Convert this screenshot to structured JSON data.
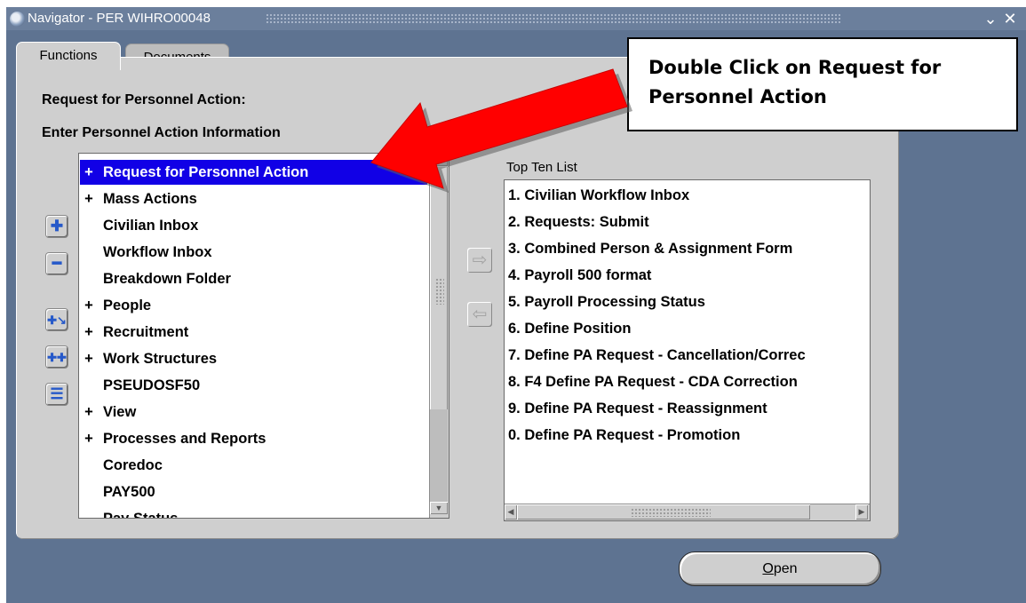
{
  "window": {
    "title": "Navigator - PER WIHRO00048",
    "minimize_glyph": "⯆",
    "close_glyph": "✕"
  },
  "tabs": [
    {
      "label": "Functions",
      "active": true
    },
    {
      "label": "Documents",
      "active": false
    }
  ],
  "headings": {
    "line1": "Request for Personnel Action:",
    "line2": "Enter Personnel Action Information"
  },
  "tree": {
    "items": [
      {
        "plus": "+",
        "label": "Request for Personnel Action",
        "selected": true
      },
      {
        "plus": "+",
        "label": "Mass Actions"
      },
      {
        "plus": "",
        "label": "Civilian Inbox"
      },
      {
        "plus": "",
        "label": "Workflow Inbox"
      },
      {
        "plus": "",
        "label": "Breakdown Folder"
      },
      {
        "plus": "+",
        "label": "People"
      },
      {
        "plus": "+",
        "label": "Recruitment"
      },
      {
        "plus": "+",
        "label": "Work Structures"
      },
      {
        "plus": "",
        "label": "PSEUDOSF50"
      },
      {
        "plus": "+",
        "label": "View"
      },
      {
        "plus": "+",
        "label": "Processes and Reports"
      },
      {
        "plus": "",
        "label": "Coredoc"
      },
      {
        "plus": "",
        "label": "PAY500"
      },
      {
        "plus": "",
        "label": "Pay Status"
      }
    ]
  },
  "side_buttons": {
    "expand_icon": "plus-icon",
    "collapse_icon": "minus-icon",
    "expand_branch_icon": "expand-branch-icon",
    "expand_all_icon": "expand-all-icon",
    "collapse_all_icon": "collapse-all-icon"
  },
  "top_ten": {
    "title": "Top Ten List",
    "items": [
      "1. Civilian Workflow Inbox",
      "2. Requests: Submit",
      "3. Combined Person & Assignment Form",
      "4. Payroll 500 format",
      "5. Payroll Processing Status",
      "6. Define  Position",
      "7. Define PA Request - Cancellation/Correc",
      "8. F4 Define PA Request - CDA Correction",
      "9. Define PA Request - Reassignment",
      "0. Define PA Request - Promotion"
    ]
  },
  "buttons": {
    "open_underlined": "O",
    "open_rest": "pen"
  },
  "annotation": {
    "text": "Double Click on Request for Personnel Action",
    "arrow_color": "#ff0000"
  },
  "colors": {
    "window_bg": "#5e7391",
    "selection": "#1100e6",
    "panel": "#cfcfcf"
  }
}
